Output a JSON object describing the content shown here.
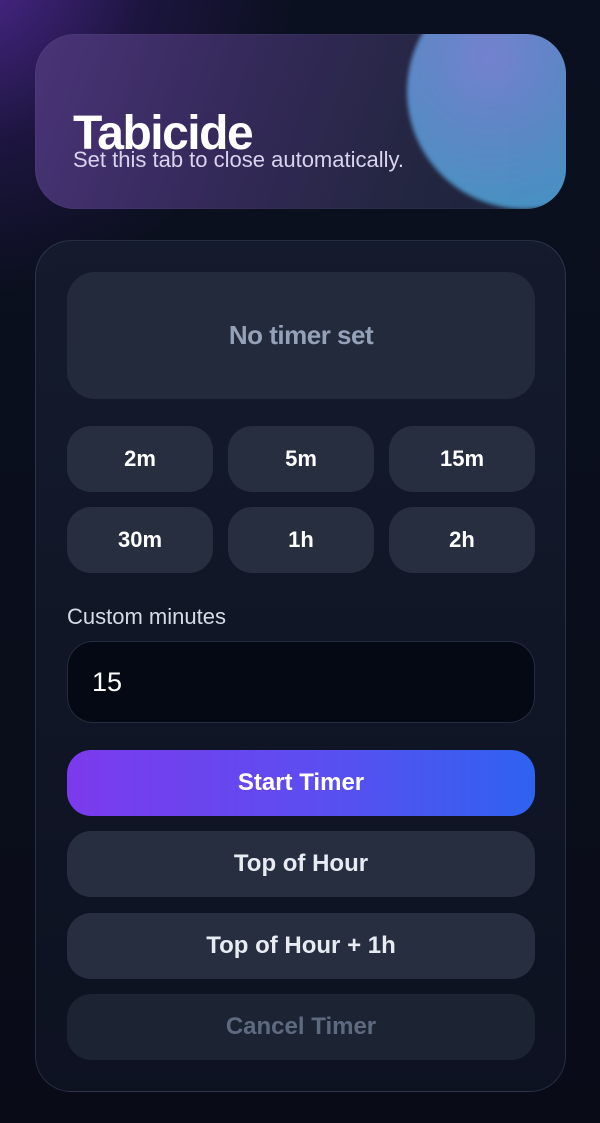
{
  "app": {
    "title": "Tabicide",
    "subtitle": "Set this tab to close automatically."
  },
  "status": {
    "text": "No timer set"
  },
  "presets": [
    {
      "label": "2m"
    },
    {
      "label": "5m"
    },
    {
      "label": "15m"
    },
    {
      "label": "30m"
    },
    {
      "label": "1h"
    },
    {
      "label": "2h"
    }
  ],
  "custom": {
    "label": "Custom minutes",
    "value": "15"
  },
  "actions": {
    "start_label": "Start Timer",
    "top_of_hour_label": "Top of Hour",
    "top_of_hour_plus_label": "Top of Hour + 1h",
    "cancel_label": "Cancel Timer",
    "cancel_disabled": true
  },
  "colors": {
    "accent_start": "#7c3aed",
    "accent_end": "#2f62f0",
    "card_bg": "#161c2e",
    "button_bg": "#262e40",
    "status_text": "#94a1b8",
    "disabled_text": "#5e6a80"
  }
}
